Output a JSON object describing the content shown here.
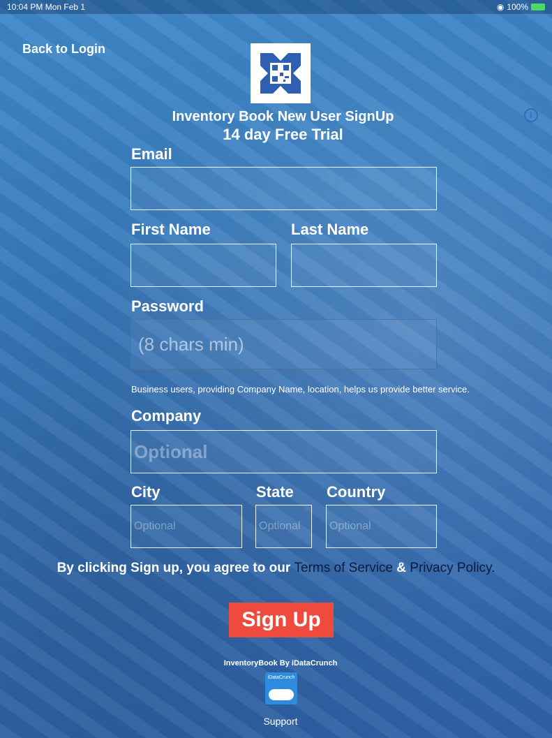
{
  "status_bar": {
    "time": "10:04 PM  Mon Feb 1",
    "battery": "100%"
  },
  "nav": {
    "back_label": "Back to Login"
  },
  "header": {
    "title": "Inventory Book New User SignUp",
    "subtitle": "14 day Free Trial"
  },
  "form": {
    "email_label": "Email",
    "email_placeholder": "",
    "first_name_label": "First Name",
    "last_name_label": "Last Name",
    "password_label": "Password",
    "password_placeholder": "(8 chars min)",
    "business_note": "Business users, providing Company Name,  location, helps us provide better service.",
    "company_label": "Company",
    "company_placeholder": "Optional",
    "city_label": "City",
    "city_placeholder": "Optional",
    "state_label": "State",
    "state_placeholder": "Optional",
    "country_label": "Country",
    "country_placeholder": "Optional"
  },
  "terms": {
    "prefix": "By clicking Sign up, you agree to our",
    "tos": "Terms of Service",
    "amp": "&",
    "privacy": "Privacy Policy."
  },
  "actions": {
    "signup_label": "Sign Up"
  },
  "footer": {
    "brand": "InventoryBook By iDataCrunch",
    "logo_caption": "iDataCrunch",
    "support": "Support"
  },
  "colors": {
    "accent_button": "#ee4b3e",
    "background": "#3a7fc2"
  }
}
